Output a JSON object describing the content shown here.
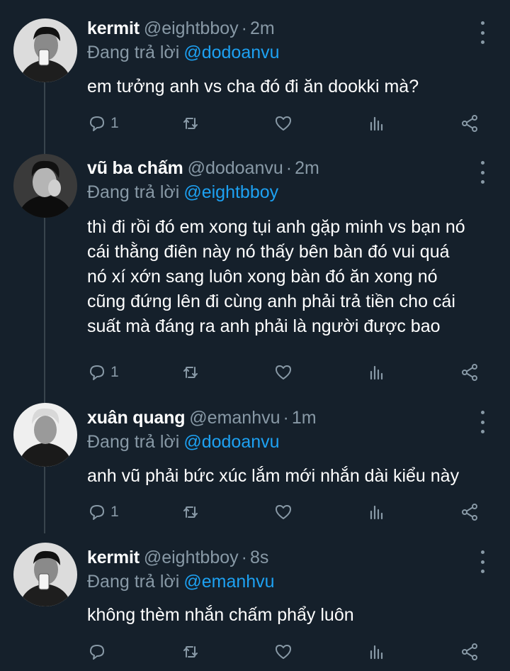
{
  "tweets": [
    {
      "name": "kermit",
      "handle": "@eightbboy",
      "dot": "·",
      "time": "2m",
      "replying_label": "Đang trả lời",
      "replying_to": "@dodoanvu",
      "lines": [
        "em tưởng anh vs cha đó đi ăn dookki mà?"
      ],
      "reply_count": "1"
    },
    {
      "name": "vũ ba chấm",
      "handle": "@dodoanvu",
      "dot": "·",
      "time": "2m",
      "replying_label": "Đang trả lời",
      "replying_to": "@eightbboy",
      "lines": [
        "thì đi rồi đó em xong tụi anh gặp minh vs bạn nó",
        "cái thằng điên này nó thấy bên bàn đó vui quá",
        "nó xí xớn sang luôn xong bàn đó ăn xong nó",
        "cũng đứng lên đi cùng anh phải trả tiền cho cái",
        "suất mà đáng ra anh phải là người được bao"
      ],
      "reply_count": "1"
    },
    {
      "name": "xuân quang",
      "handle": "@emanhvu",
      "dot": "·",
      "time": "1m",
      "replying_label": "Đang trả lời",
      "replying_to": "@dodoanvu",
      "lines": [
        "anh vũ phải bức xúc lắm mới nhắn dài kiểu này"
      ],
      "reply_count": "1"
    },
    {
      "name": "kermit",
      "handle": "@eightbboy",
      "dot": "·",
      "time": "8s",
      "replying_label": "Đang trả lời",
      "replying_to": "@emanhvu",
      "lines": [
        "không thèm nhắn chấm phẩy luôn"
      ],
      "reply_count": ""
    }
  ],
  "icons": {
    "reply": "reply-icon",
    "retweet": "retweet-icon",
    "like": "heart-icon",
    "analytics": "analytics-icon",
    "share": "share-icon",
    "more": "more-options-icon"
  },
  "colors": {
    "background": "#15202b",
    "secondary_text": "#8899a6",
    "mention": "#1da1f2",
    "thread_line": "#38444d"
  }
}
